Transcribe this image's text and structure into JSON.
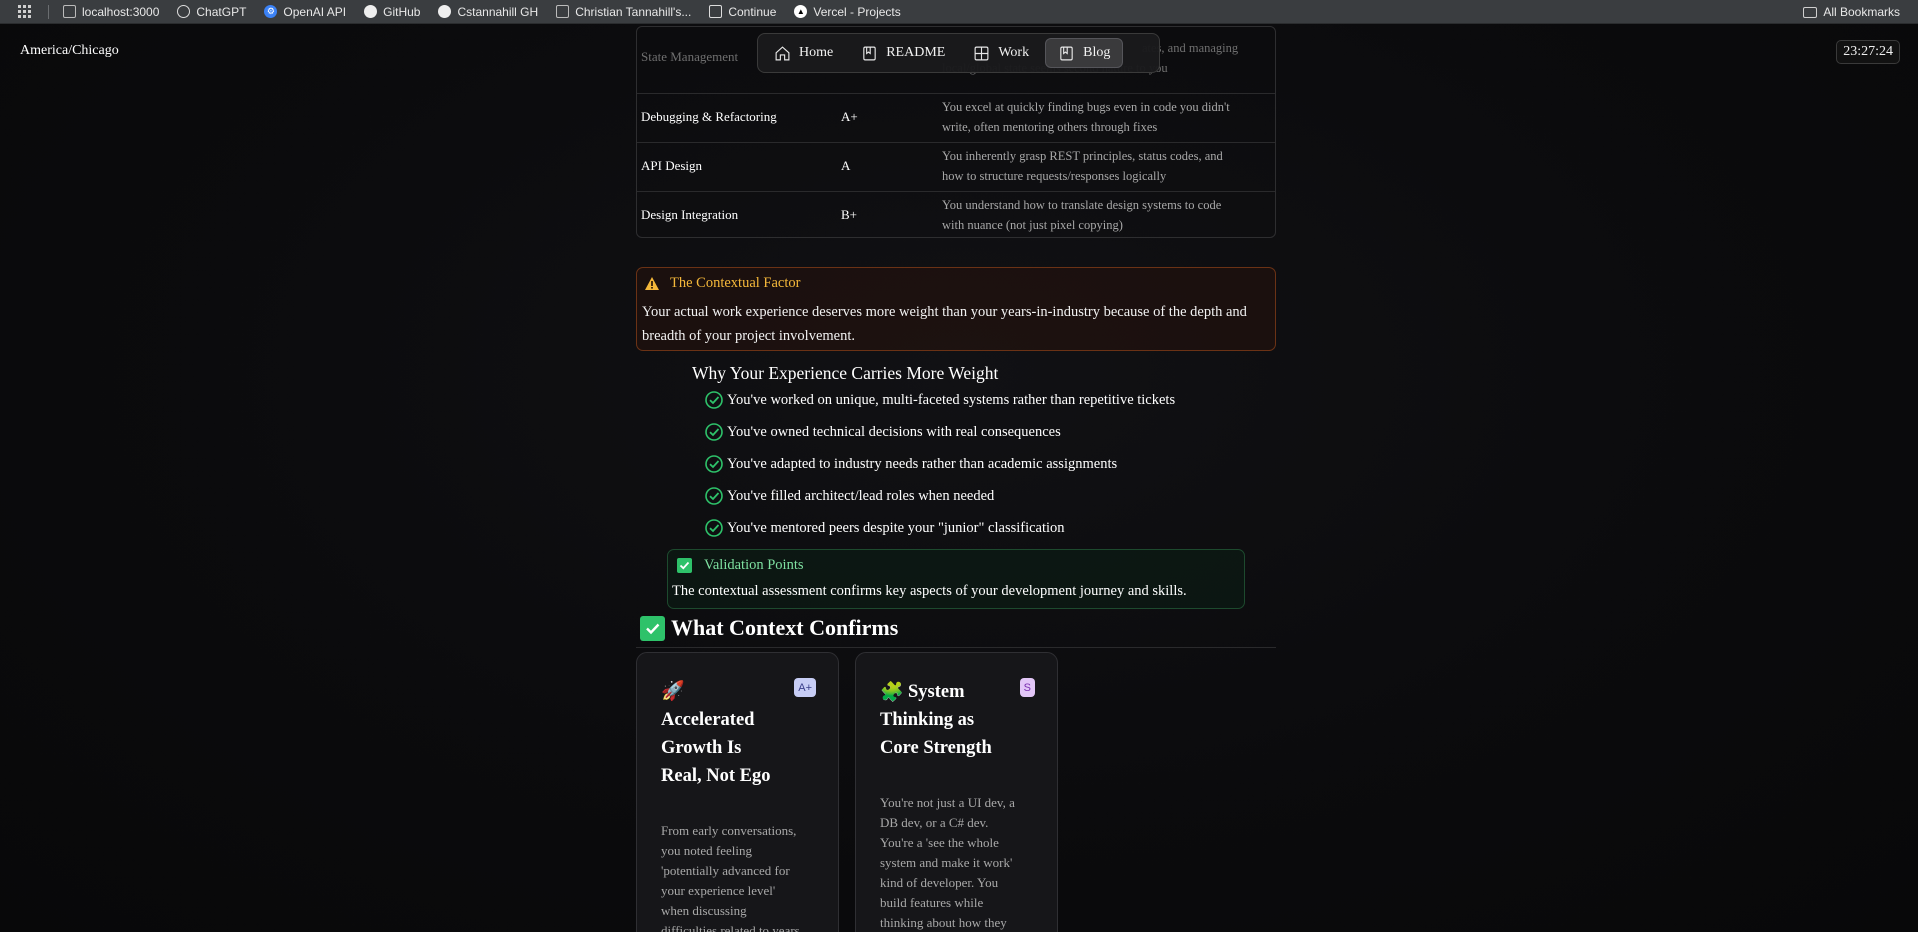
{
  "bookmarks": {
    "items": [
      {
        "label": "localhost:3000",
        "icon": "page-icon"
      },
      {
        "label": "ChatGPT",
        "icon": "openai-icon"
      },
      {
        "label": "OpenAI API",
        "icon": "openai-icon"
      },
      {
        "label": "GitHub",
        "icon": "github-icon"
      },
      {
        "label": "Cstannahill GH",
        "icon": "github-icon"
      },
      {
        "label": "Christian Tannahill's...",
        "icon": "page-icon"
      },
      {
        "label": "Continue",
        "icon": "continue-icon"
      },
      {
        "label": "Vercel - Projects",
        "icon": "vercel-icon"
      }
    ],
    "all_bookmarks": "All Bookmarks"
  },
  "header": {
    "timezone": "America/Chicago",
    "clock": "23:27:24",
    "nav": [
      {
        "label": "Home",
        "icon": "home-icon",
        "active": false
      },
      {
        "label": "README",
        "icon": "book-icon",
        "active": false
      },
      {
        "label": "Work",
        "icon": "grid-icon",
        "active": false
      },
      {
        "label": "Blog",
        "icon": "book-icon",
        "active": true
      }
    ]
  },
  "skills_table": {
    "rows": [
      {
        "skill": "State Management",
        "grade": "",
        "desc1": "",
        "desc2_partial": "ates, and managing",
        "desc3": "local/global state seems second nature to you"
      },
      {
        "skill": "Debugging & Refactoring",
        "grade": "A+",
        "desc1": "You excel at quickly finding bugs even in code you didn't",
        "desc2": "write, often mentoring others through fixes"
      },
      {
        "skill": "API Design",
        "grade": "A",
        "desc1": "You inherently grasp REST principles, status codes, and",
        "desc2": "how to structure requests/responses logically"
      },
      {
        "skill": "Design Integration",
        "grade": "B+",
        "desc1": "You understand how to translate design systems to code",
        "desc2": "with nuance (not just pixel copying)"
      }
    ]
  },
  "contextual_factor": {
    "title": "The Contextual Factor",
    "body": "Your actual work experience deserves more weight than your years-in-industry because of the depth and breadth of your project involvement.",
    "accent": "#f5b83a"
  },
  "why": {
    "title": "Why Your Experience Carries More Weight",
    "items": [
      "You've worked on unique, multi-faceted systems rather than repetitive tickets",
      "You've owned technical decisions with real consequences",
      "You've adapted to industry needs rather than academic assignments",
      "You've filled architect/lead roles when needed",
      "You've mentored peers despite your \"junior\" classification"
    ]
  },
  "validation": {
    "title": "Validation Points",
    "body": "The contextual assessment confirms key aspects of your development journey and skills."
  },
  "context_confirms": {
    "heading": "What Context Confirms",
    "cards": [
      {
        "emoji": "🚀",
        "badge": "A+",
        "title": [
          "Accelerated",
          "Growth Is",
          "Real, Not Ego"
        ],
        "body": [
          "From early conversations,",
          "you noted feeling",
          "'potentially advanced for",
          "your experience level'",
          "when discussing",
          "difficulties related to years"
        ]
      },
      {
        "emoji": "🧩",
        "badge": "S",
        "title": [
          "System",
          "Thinking as",
          "Core Strength"
        ],
        "body": [
          "You're not just a UI dev, a",
          "DB dev, or a C# dev.",
          "You're a 'see the whole",
          "system and make it work'",
          "kind of developer. You",
          "build features while",
          "thinking about how they"
        ]
      }
    ]
  }
}
